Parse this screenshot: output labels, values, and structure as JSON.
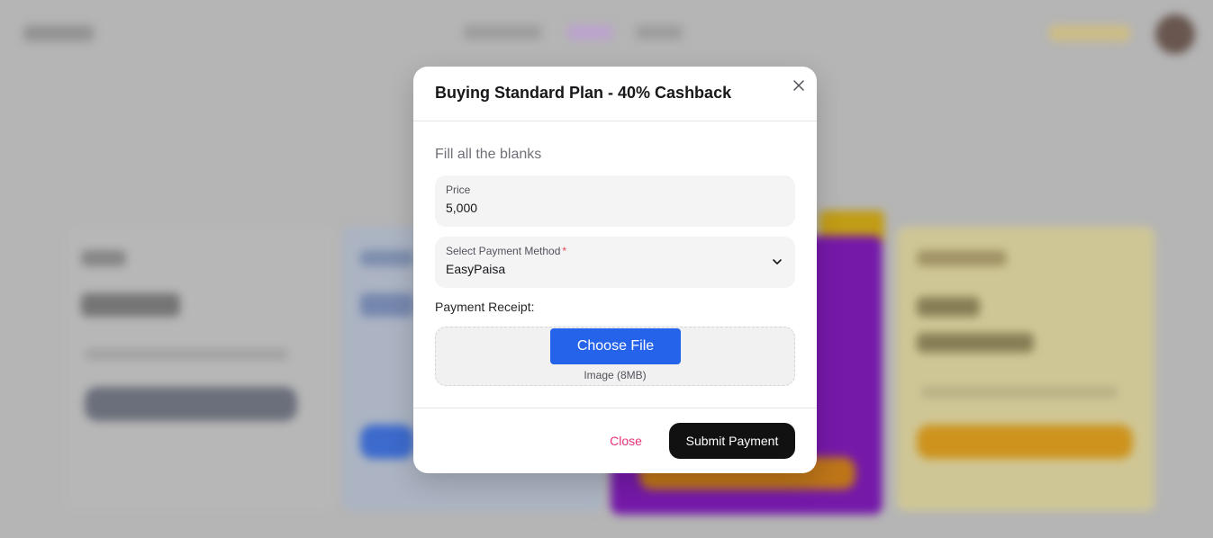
{
  "modal": {
    "title": "Buying Standard Plan - 40% Cashback",
    "close_icon": "close-icon",
    "subtitle": "Fill all the blanks",
    "price": {
      "label": "Price",
      "value": "5,000"
    },
    "payment_method": {
      "label": "Select Payment Method",
      "required_marker": "*",
      "value": "EasyPaisa",
      "icon": "chevron-down-icon"
    },
    "receipt": {
      "label": "Payment Receipt:",
      "button_label": "Choose File",
      "hint": "Image (8MB)"
    },
    "footer": {
      "close_label": "Close",
      "submit_label": "Submit Payment"
    }
  },
  "colors": {
    "primary_button": "#2563eb",
    "submit_button": "#111111",
    "close_text": "#e5347a",
    "required": "#e5484d"
  }
}
